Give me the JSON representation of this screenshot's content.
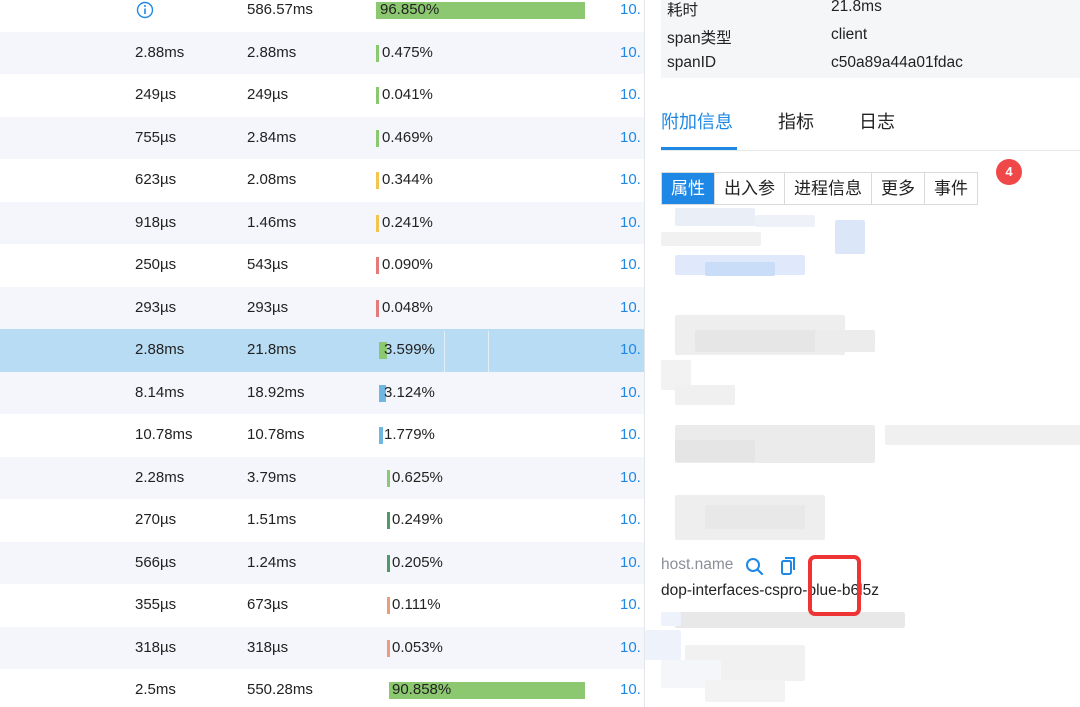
{
  "table": {
    "rows": [
      {
        "self": "",
        "total": "586.57ms",
        "pct": "96.850%",
        "pct_value": 96.85,
        "bar_color": "#8cc870",
        "link": "10.",
        "info_icon": true
      },
      {
        "self": "2.88ms",
        "total": "2.88ms",
        "pct": "0.475%",
        "pct_value": 0.475,
        "bar_color": "#8cc870",
        "link": "10."
      },
      {
        "self": "249µs",
        "total": "249µs",
        "pct": "0.041%",
        "pct_value": 0.041,
        "bar_color": "#8cc870",
        "link": "10."
      },
      {
        "self": "755µs",
        "total": "2.84ms",
        "pct": "0.469%",
        "pct_value": 0.469,
        "bar_color": "#8cc870",
        "link": "10."
      },
      {
        "self": "623µs",
        "total": "2.08ms",
        "pct": "0.344%",
        "pct_value": 0.344,
        "bar_color": "#f2c550",
        "link": "10."
      },
      {
        "self": "918µs",
        "total": "1.46ms",
        "pct": "0.241%",
        "pct_value": 0.241,
        "bar_color": "#f2c550",
        "link": "10."
      },
      {
        "self": "250µs",
        "total": "543µs",
        "pct": "0.090%",
        "pct_value": 0.09,
        "bar_color": "#e57a7a",
        "link": "10."
      },
      {
        "self": "293µs",
        "total": "293µs",
        "pct": "0.048%",
        "pct_value": 0.048,
        "bar_color": "#e57a7a",
        "link": "10."
      },
      {
        "self": "2.88ms",
        "total": "21.8ms",
        "pct": "3.599%",
        "pct_value": 3.599,
        "bar_color": "#8cc870",
        "link": "10.",
        "selected": true
      },
      {
        "self": "8.14ms",
        "total": "18.92ms",
        "pct": "3.124%",
        "pct_value": 3.124,
        "bar_color": "#6fb6e0",
        "link": "10."
      },
      {
        "self": "10.78ms",
        "total": "10.78ms",
        "pct": "1.779%",
        "pct_value": 1.779,
        "bar_color": "#6fb6e0",
        "link": "10."
      },
      {
        "self": "2.28ms",
        "total": "3.79ms",
        "pct": "0.625%",
        "pct_value": 0.625,
        "bar_color": "#8cc870",
        "link": "10."
      },
      {
        "self": "270µs",
        "total": "1.51ms",
        "pct": "0.249%",
        "pct_value": 0.249,
        "bar_color": "#4f9a6a",
        "link": "10."
      },
      {
        "self": "566µs",
        "total": "1.24ms",
        "pct": "0.205%",
        "pct_value": 0.205,
        "bar_color": "#4f9a6a",
        "link": "10."
      },
      {
        "self": "355µs",
        "total": "673µs",
        "pct": "0.111%",
        "pct_value": 0.111,
        "bar_color": "#ef9a7a",
        "link": "10."
      },
      {
        "self": "318µs",
        "total": "318µs",
        "pct": "0.053%",
        "pct_value": 0.053,
        "bar_color": "#ef9a7a",
        "link": "10."
      },
      {
        "self": "2.5ms",
        "total": "550.28ms",
        "pct": "90.858%",
        "pct_value": 90.858,
        "bar_color": "#8cc870",
        "link": "10."
      }
    ]
  },
  "detail": {
    "duration_label": "耗时",
    "duration_value": "21.8ms",
    "span_type_label": "span类型",
    "span_type_value": "client",
    "span_id_label": "spanID",
    "span_id_value": "c50a89a44a01fdac"
  },
  "tabs": [
    "附加信息",
    "指标",
    "日志"
  ],
  "subtabs": [
    "属性",
    "出入参",
    "进程信息",
    "更多",
    "事件"
  ],
  "event_badge": "4",
  "attribute": {
    "key": "host.name",
    "value": "dop-interfaces-cspro-blue-b6l5z"
  },
  "colors": {
    "accent": "#1f88e5",
    "selected_row": "#b8dcf4",
    "badge": "#f04848",
    "highlight_box": "#ee3434"
  }
}
